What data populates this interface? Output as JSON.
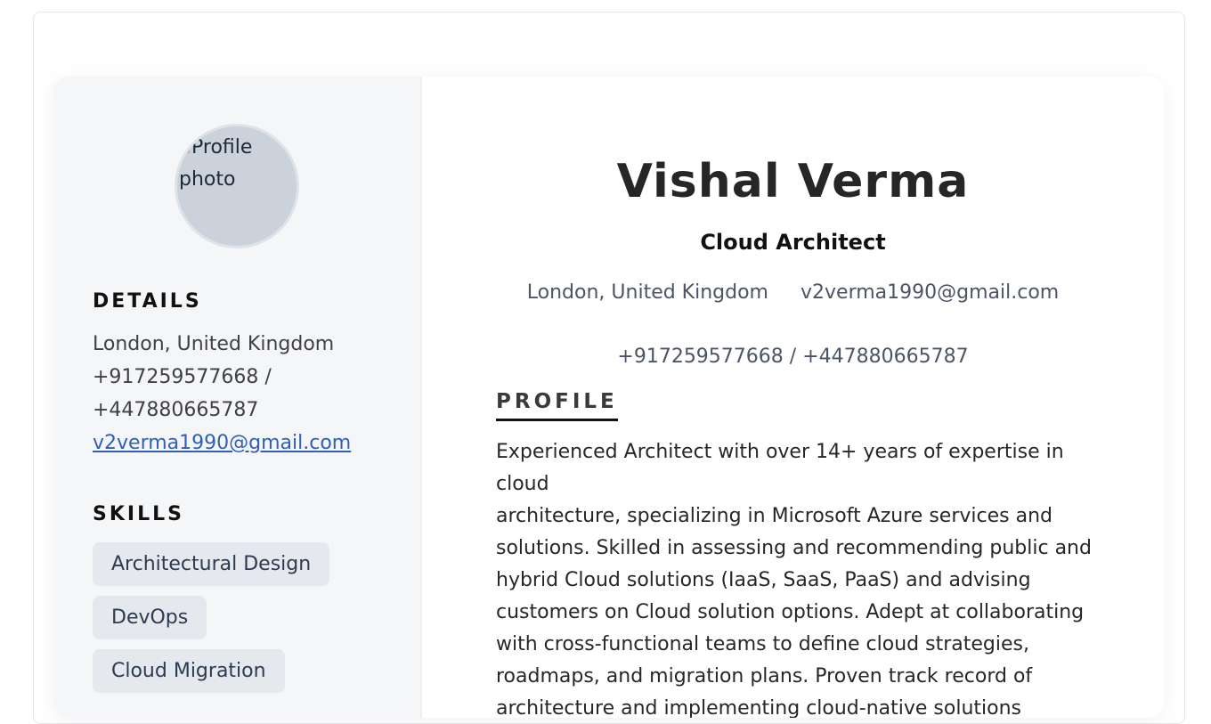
{
  "sidebar": {
    "avatar_alt": "Profile photo",
    "details_heading": "DETAILS",
    "details": {
      "location": "London, United Kingdom",
      "phone_line1": "+917259577668 /",
      "phone_line2": "+447880665787",
      "email": "v2verma1990@gmail.com"
    },
    "skills_heading": "SKILLS",
    "skills": [
      "Architectural Design",
      "DevOps",
      "Cloud Migration"
    ]
  },
  "header": {
    "name": "Vishal Verma",
    "role": "Cloud Architect",
    "location": "London, United Kingdom",
    "email": "v2verma1990@gmail.com",
    "phones": "+917259577668 / +447880665787"
  },
  "profile": {
    "heading": "PROFILE",
    "lines": [
      "Experienced Architect with over 14+ years of expertise in cloud",
      "architecture, specializing in Microsoft Azure services and",
      "solutions. Skilled in assessing and recommending public and",
      "hybrid Cloud solutions (IaaS, SaaS, PaaS) and advising",
      "customers on Cloud solution options. Adept at collaborating",
      "with cross-functional teams to define cloud strategies,",
      "roadmaps, and migration plans. Proven track record of",
      "architecture and implementing cloud-native solutions"
    ]
  }
}
